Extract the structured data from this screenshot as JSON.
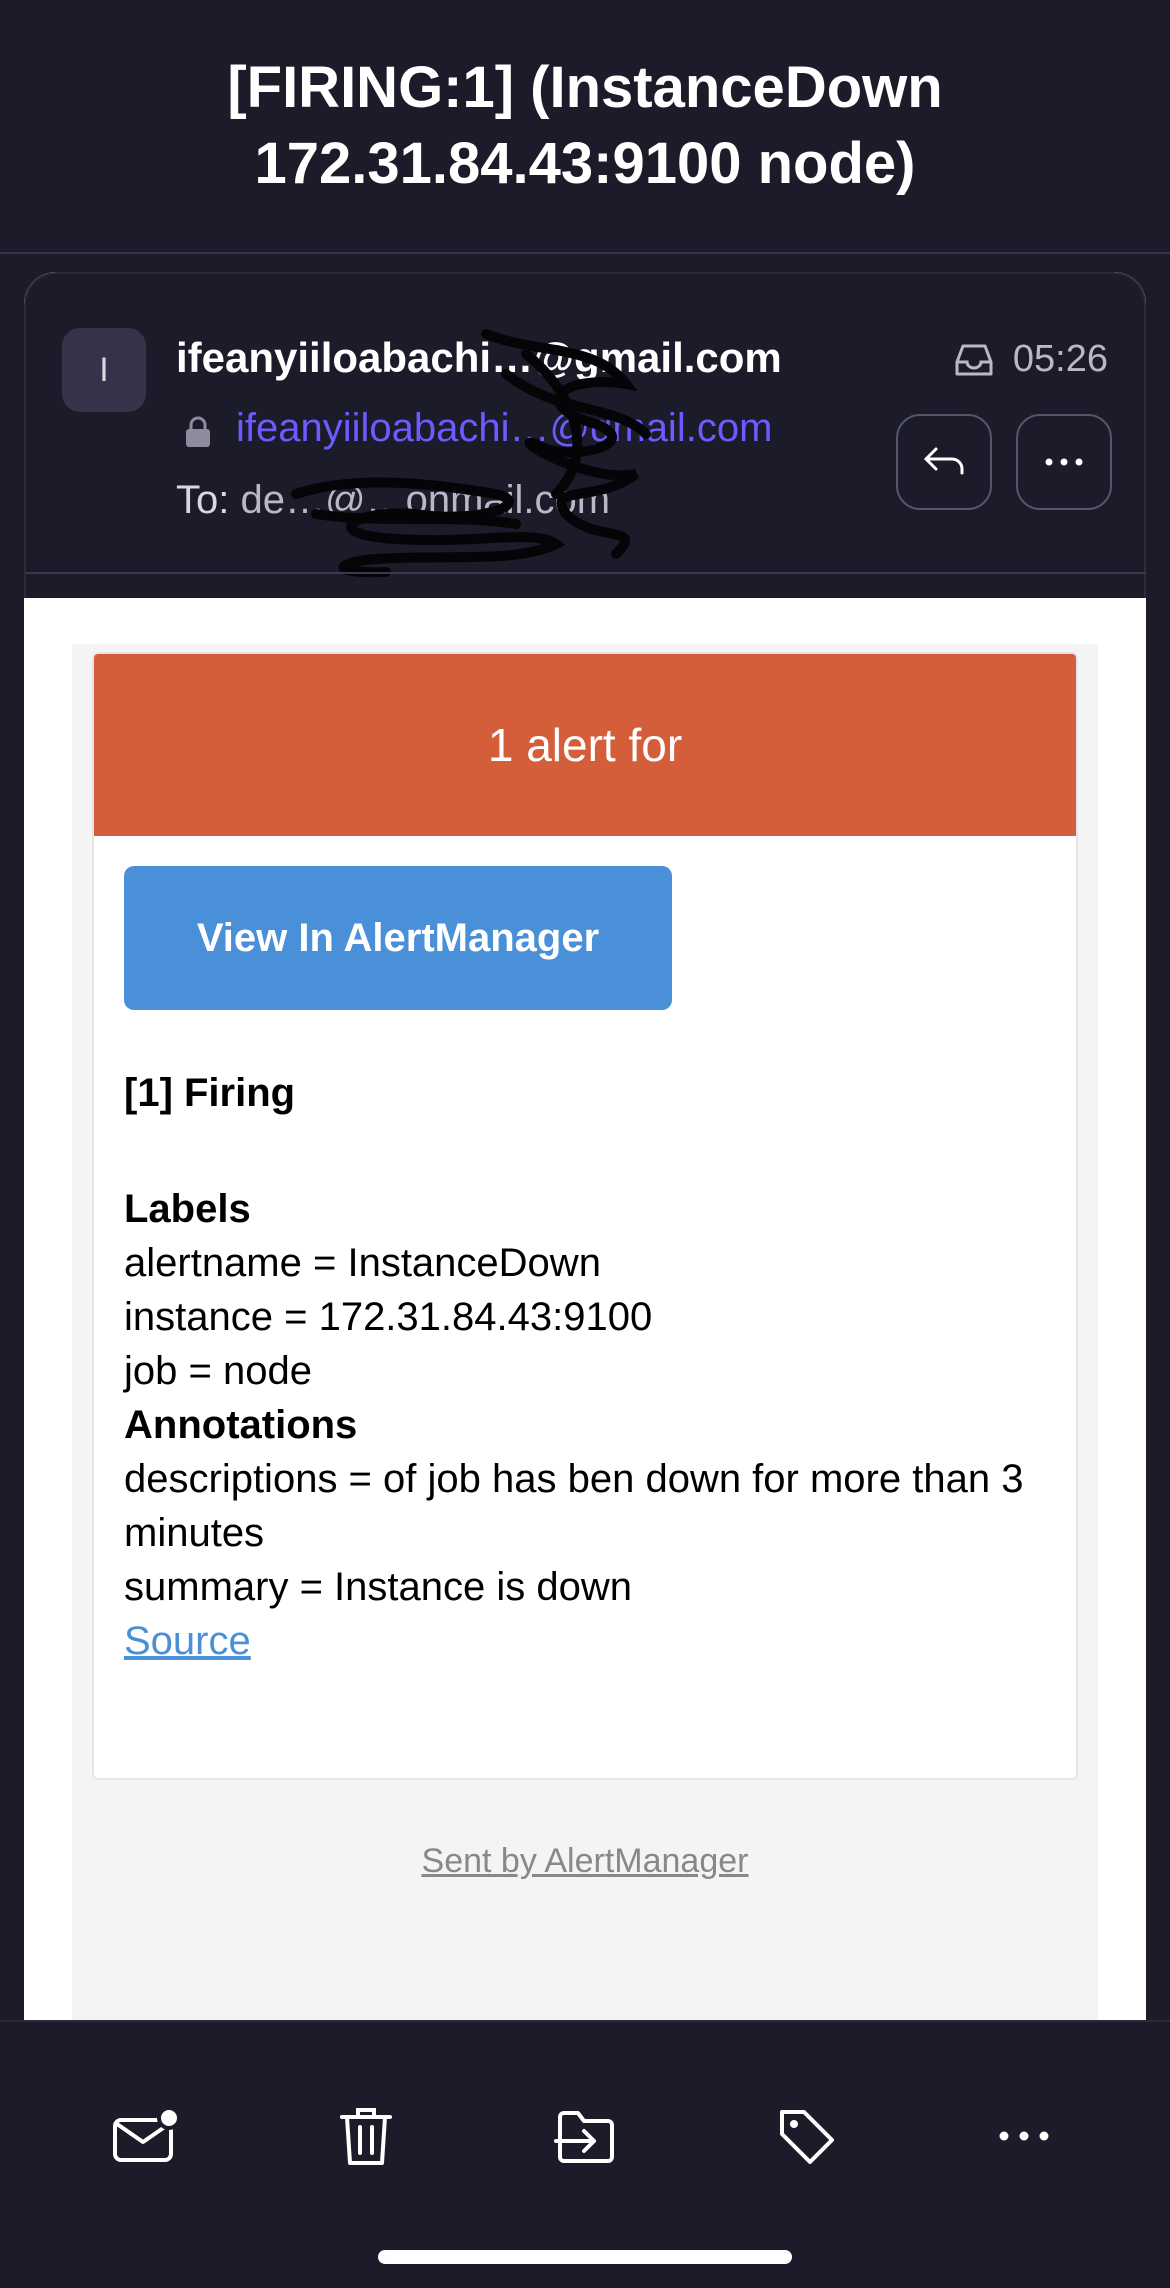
{
  "subject": "[FIRING:1]  (InstanceDown 172.31.84.43:9100 node)",
  "sender": {
    "avatar_letter": "I",
    "name": "ifeanyiiloabachi…@gmail.com",
    "address": "ifeanyiiloabachi…@gmail.com",
    "to_label": "To:",
    "to_address": "de…@…onmail.com",
    "time": "05:26"
  },
  "alert": {
    "header": "1 alert for",
    "button_label": "View In AlertManager",
    "firing_title": "[1] Firing",
    "labels_heading": "Labels",
    "labels": [
      "alertname = InstanceDown",
      "instance = 172.31.84.43:9100",
      "job = node"
    ],
    "annotations_heading": "Annotations",
    "annotations": [
      "descriptions = of job has ben down for more than 3 minutes",
      "summary = Instance is down"
    ],
    "source_link": "Source",
    "footer": "Sent by AlertManager"
  },
  "toolbar": {
    "icons": [
      "mark-unread-icon",
      "trash-icon",
      "move-icon",
      "label-icon",
      "more-icon"
    ]
  },
  "colors": {
    "background": "#1c1b29",
    "alert_header": "#d45d3a",
    "button": "#4a90d9",
    "sender_link": "#6a5cff"
  }
}
